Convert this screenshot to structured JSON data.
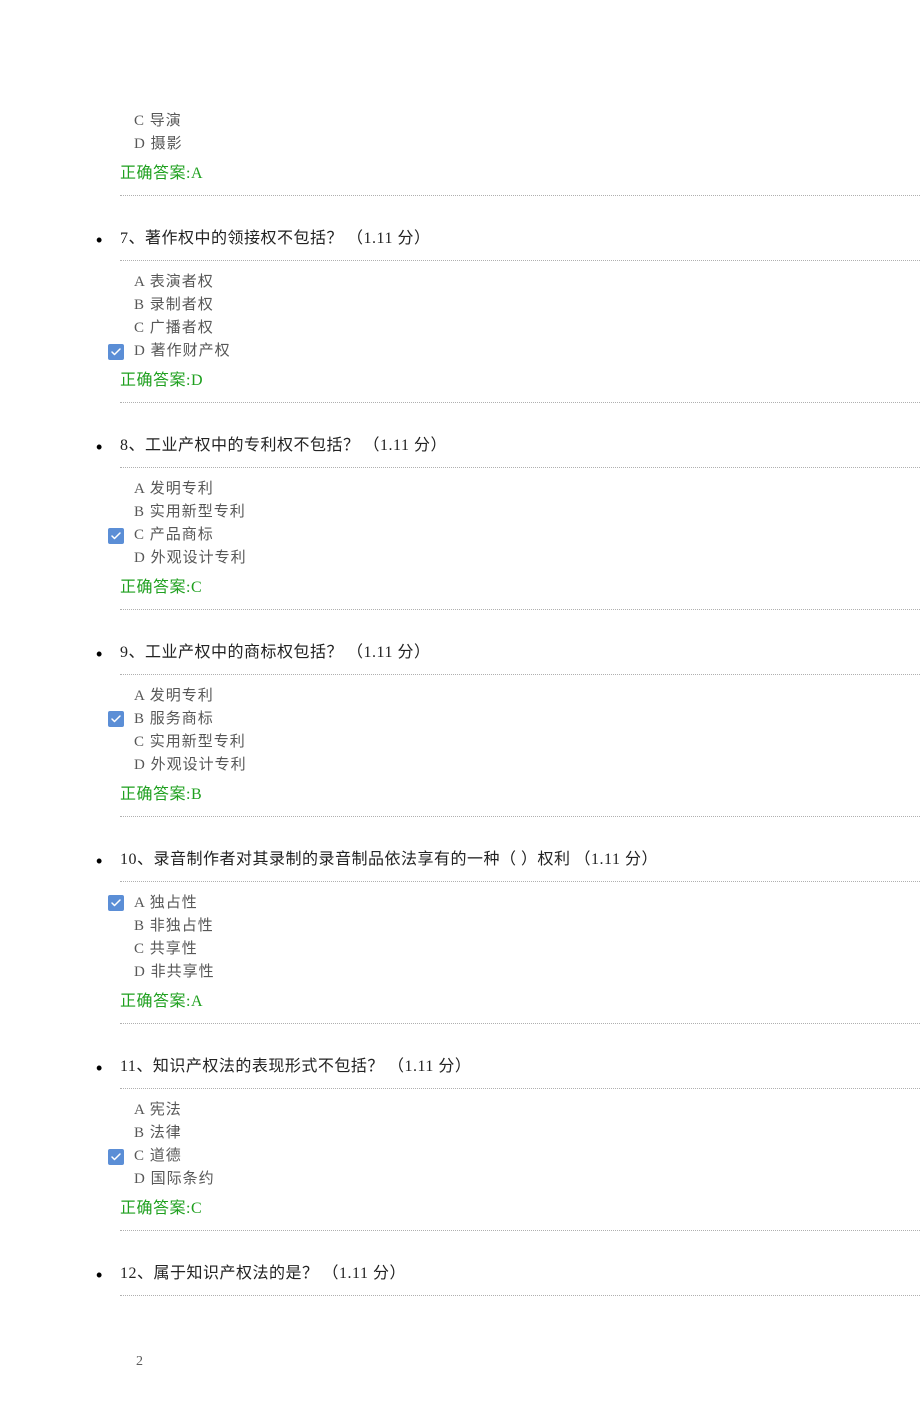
{
  "meta": {
    "answer_label_prefix": "正确答案:"
  },
  "prefix_question": {
    "options": [
      {
        "key": "C",
        "text": "导演",
        "checked": false
      },
      {
        "key": "D",
        "text": "摄影",
        "checked": false
      }
    ],
    "answer": "A"
  },
  "questions": [
    {
      "number": "7",
      "title": "著作权中的领接权不包括？",
      "points": "（1.11  分）",
      "options": [
        {
          "key": "A",
          "text": "表演者权",
          "checked": false
        },
        {
          "key": "B",
          "text": "录制者权",
          "checked": false
        },
        {
          "key": "C",
          "text": "广播者权",
          "checked": false
        },
        {
          "key": "D",
          "text": "著作财产权",
          "checked": true
        }
      ],
      "answer": "D"
    },
    {
      "number": "8",
      "title": "工业产权中的专利权不包括？",
      "points": "（1.11  分）",
      "options": [
        {
          "key": "A",
          "text": "发明专利",
          "checked": false
        },
        {
          "key": "B",
          "text": "实用新型专利",
          "checked": false
        },
        {
          "key": "C",
          "text": "产品商标",
          "checked": true
        },
        {
          "key": "D",
          "text": "外观设计专利",
          "checked": false
        }
      ],
      "answer": "C"
    },
    {
      "number": "9",
      "title": "工业产权中的商标权包括？",
      "points": "（1.11  分）",
      "options": [
        {
          "key": "A",
          "text": "发明专利",
          "checked": false
        },
        {
          "key": "B",
          "text": "服务商标",
          "checked": true
        },
        {
          "key": "C",
          "text": "实用新型专利",
          "checked": false
        },
        {
          "key": "D",
          "text": "外观设计专利",
          "checked": false
        }
      ],
      "answer": "B"
    },
    {
      "number": "10",
      "title": "录音制作者对其录制的录音制品依法享有的一种（ ）权利",
      "points": "（1.11  分）",
      "options": [
        {
          "key": "A",
          "text": "独占性",
          "checked": true
        },
        {
          "key": "B",
          "text": "非独占性",
          "checked": false
        },
        {
          "key": "C",
          "text": "共享性",
          "checked": false
        },
        {
          "key": "D",
          "text": "非共享性",
          "checked": false
        }
      ],
      "answer": "A"
    },
    {
      "number": "11",
      "title": "知识产权法的表现形式不包括？",
      "points": "（1.11  分）",
      "options": [
        {
          "key": "A",
          "text": "宪法",
          "checked": false
        },
        {
          "key": "B",
          "text": "法律",
          "checked": false
        },
        {
          "key": "C",
          "text": "道德",
          "checked": true
        },
        {
          "key": "D",
          "text": "国际条约",
          "checked": false
        }
      ],
      "answer": "C"
    },
    {
      "number": "12",
      "title": "属于知识产权法的是？",
      "points": "（1.11  分）",
      "options": [],
      "answer": null
    }
  ],
  "page_number": "2"
}
